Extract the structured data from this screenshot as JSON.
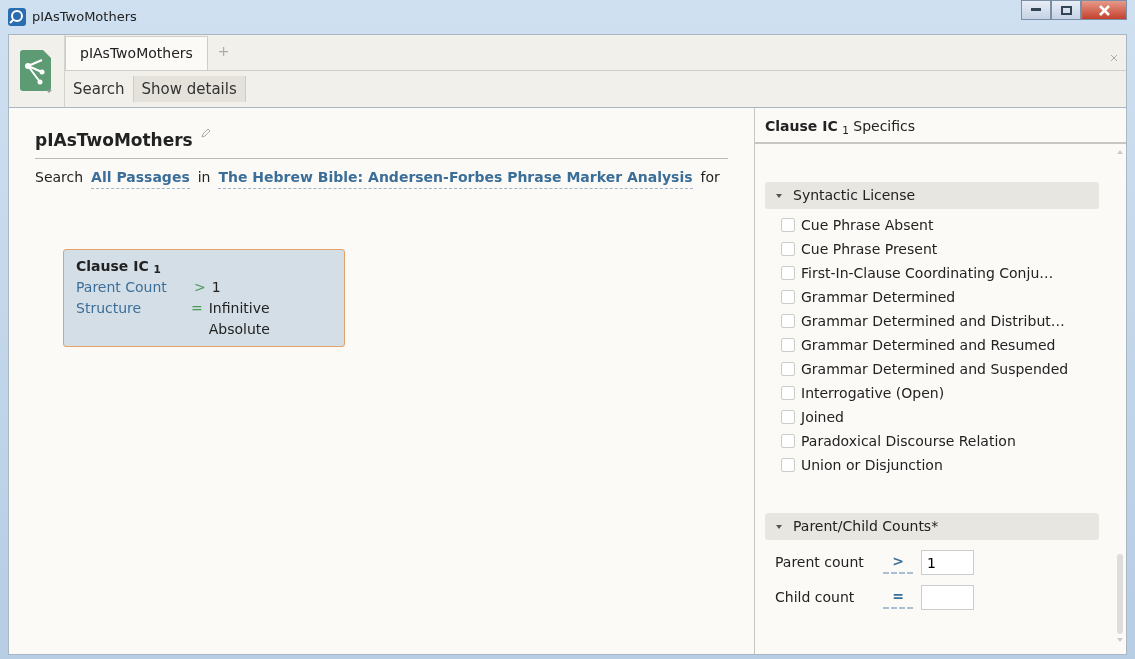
{
  "window": {
    "title": "pIAsTwoMothers"
  },
  "tabs": [
    {
      "label": "pIAsTwoMothers",
      "selected": true
    }
  ],
  "add_tab": "+",
  "toolbar": {
    "buttons": [
      "Search",
      "Show details"
    ]
  },
  "document": {
    "title": "pIAsTwoMothers",
    "search_line": {
      "prefix": "Search",
      "scope": "All Passages",
      "joiner": "in",
      "resource": "The Hebrew Bible: Andersen-Forbes Phrase Marker Analysis",
      "suffix": "for"
    },
    "clause_box": {
      "title": "Clause IC $_{1}$",
      "conditions": [
        {
          "field": "Parent Count",
          "operator": ">",
          "value": "1"
        },
        {
          "field": "Structure",
          "operator": "=",
          "value": "Infinitive Absolute"
        }
      ]
    }
  },
  "panel": {
    "title": "**Clause IC** $_{1}$ Specifics",
    "sections": [
      {
        "kind": "checkboxes",
        "title": "Syntactic License",
        "expanded": true,
        "items": [
          {
            "label": "Cue Phrase Absent",
            "checked": false
          },
          {
            "label": "Cue Phrase Present",
            "checked": false
          },
          {
            "label": "First-In-Clause Coordinating Conju…",
            "checked": false
          },
          {
            "label": "Grammar Determined",
            "checked": false
          },
          {
            "label": "Grammar Determined and Distribut…",
            "checked": false
          },
          {
            "label": "Grammar Determined and Resumed",
            "checked": false
          },
          {
            "label": "Grammar Determined and Suspended",
            "checked": false
          },
          {
            "label": "Interrogative (Open)",
            "checked": false
          },
          {
            "label": "Joined",
            "checked": false
          },
          {
            "label": "Paradoxical Discourse Relation",
            "checked": false
          },
          {
            "label": "Union or Disjunction",
            "checked": false
          }
        ]
      },
      {
        "kind": "counts",
        "title": "Parent/Child Counts*",
        "expanded": true,
        "rows": [
          {
            "label": "Parent count",
            "operator": ">",
            "value": "1"
          },
          {
            "label": "Child count",
            "operator": "="
          }
        ]
      }
    ]
  }
}
